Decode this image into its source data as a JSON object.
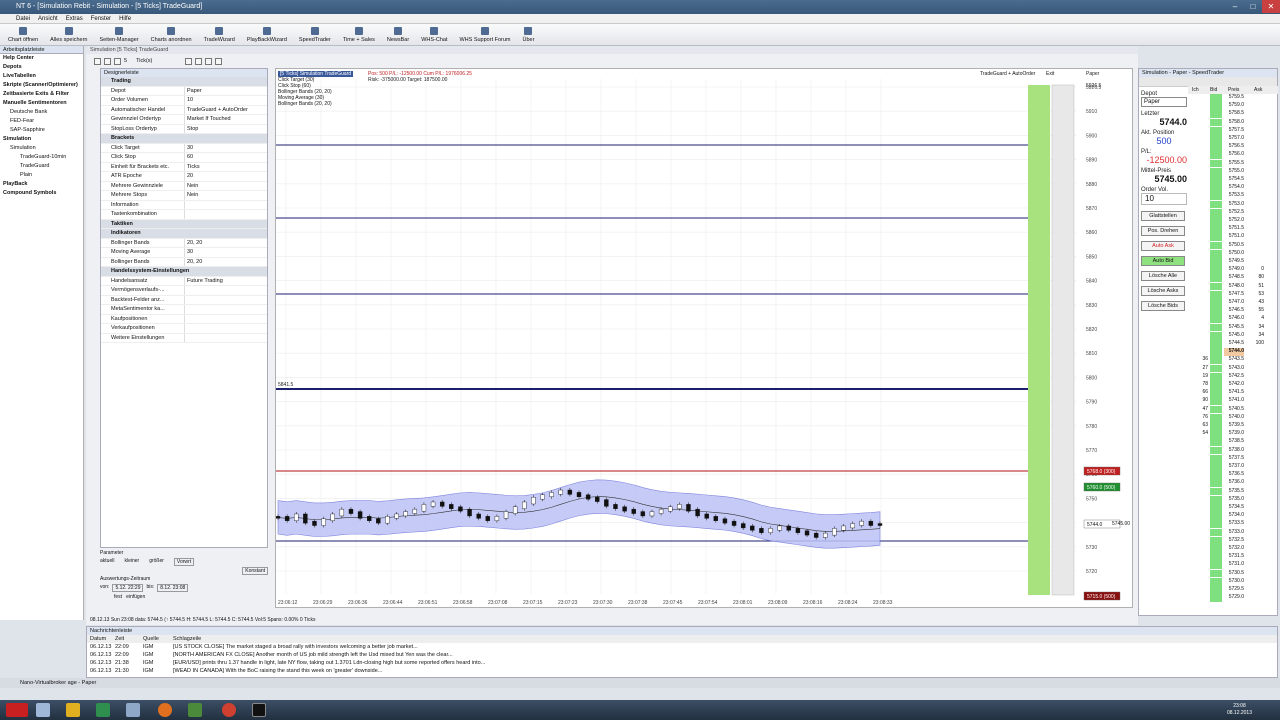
{
  "window": {
    "title": "NT 6 - [Simulation Rebit - Simulation - [5 Ticks] TradeGuard]",
    "min": "–",
    "max": "□",
    "close": "✕"
  },
  "menu": [
    "Datei",
    "Ansicht",
    "Extras",
    "Fenster",
    "Hilfe"
  ],
  "toolbar": [
    "Chart öffnen",
    "Alles speichern",
    "Seiten-Manager",
    "Charts anordnen",
    "TradeWizard",
    "PlayBackWizard",
    "SpeedTrader",
    "Time + Sales",
    "NewsBar",
    "WHS-Chat",
    "WHS Support Forum",
    "Über"
  ],
  "sidebar": {
    "header": "Arbeitsplatzleiste",
    "items": [
      {
        "label": "Help Center",
        "cls": "b"
      },
      {
        "label": "Depots",
        "cls": "b"
      },
      {
        "label": "LiveTabellen",
        "cls": "b"
      },
      {
        "label": "Skripte (Scanner/Optimierer)",
        "cls": "b"
      },
      {
        "label": "Zeitbasierte Exits & Filter",
        "cls": "b"
      },
      {
        "label": "Manuelle Sentimentoren",
        "cls": "b"
      },
      {
        "label": "Deutsche Bank",
        "cls": "l1"
      },
      {
        "label": "FED-Fear",
        "cls": "l1"
      },
      {
        "label": "SAP-Sapphire",
        "cls": "l1"
      },
      {
        "label": "Simulation",
        "cls": "b"
      },
      {
        "label": "Simulation",
        "cls": "l1"
      },
      {
        "label": "TradeGuard-10min",
        "cls": "l2"
      },
      {
        "label": "TradeGuard",
        "cls": "l2"
      },
      {
        "label": "Plain",
        "cls": "l2"
      },
      {
        "label": "PlayBack",
        "cls": "b"
      },
      {
        "label": "Compound Symbols",
        "cls": "b"
      }
    ]
  },
  "main": {
    "title": "Simulation [5 Ticks] TradeGuard",
    "period": "5",
    "unit": "Tick(s)"
  },
  "designer": {
    "header": "Designerleiste",
    "rows": [
      {
        "k": "Trading",
        "v": "",
        "sec": true
      },
      {
        "k": "Depot",
        "v": "Paper"
      },
      {
        "k": "Order Volumen",
        "v": "10"
      },
      {
        "k": "Automatischer Handel",
        "v": "TradeGuard + AutoOrder"
      },
      {
        "k": "Gewinnziel Ordertyp",
        "v": "Market If Touched"
      },
      {
        "k": "StopLoss Ordertyp",
        "v": "Stop"
      },
      {
        "k": "Brackets",
        "v": "",
        "sec": true
      },
      {
        "k": "Click Target",
        "v": "30"
      },
      {
        "k": "Click Stop",
        "v": "60"
      },
      {
        "k": "Einheit für Brackets etc.",
        "v": "Ticks"
      },
      {
        "k": "ATR Epoche",
        "v": "20"
      },
      {
        "k": "Mehrere Gewinnziele",
        "v": "Nein"
      },
      {
        "k": "Mehrere Stops",
        "v": "Nein"
      },
      {
        "k": "Information",
        "v": ""
      },
      {
        "k": "Tastenkombination",
        "v": ""
      },
      {
        "k": "Taktiken",
        "v": "",
        "sec": true
      },
      {
        "k": "Indikatoren",
        "v": "",
        "sec": true
      },
      {
        "k": "Bollinger Bands",
        "v": "20, 20"
      },
      {
        "k": "Moving Average",
        "v": "30"
      },
      {
        "k": "Bollinger Bands",
        "v": "20, 20"
      },
      {
        "k": "Handelssystem-Einstellungen",
        "v": "",
        "sec": true
      },
      {
        "k": "Handelsansatz",
        "v": "Future Trading"
      },
      {
        "k": "Vermögensverlaufs-...",
        "v": ""
      },
      {
        "k": "Backtest-Felder anz...",
        "v": ""
      },
      {
        "k": "MetaSentimentor ka...",
        "v": ""
      },
      {
        "k": "Kaufpositionen",
        "v": ""
      },
      {
        "k": "Verkaufpositionen",
        "v": ""
      },
      {
        "k": "Weitere Einstellungen",
        "v": ""
      }
    ]
  },
  "params": {
    "title": "Parameter",
    "aktuell": "aktuell",
    "kleiner": "kleiner",
    "groesser": "größer",
    "vorwrt": "Vorwrt",
    "konstant": "Konstant",
    "zeitraum": "Auswertungs-Zeitraum",
    "von_label": "von:",
    "von": "5.12. 22:29",
    "bis_label": "bis:",
    "bis": "8.12. 23:08",
    "fest": "fest",
    "einfuegen": "einfügen"
  },
  "chart": {
    "legend": [
      "[5 Ticks] Simulation TradeGuard",
      "Click Target (30)",
      "Click Stop (60)",
      "Bollinger Bands (20, 20)",
      "Moving Average (30)",
      "Bollinger Bands (20, 20)"
    ],
    "pos_info": "Pos: 500  P/L: -12500.00  Cum P/L: 1976006.25",
    "risk_info": "Risk: -375000.00  Target: 187500.00",
    "mode_label": "TradeGuard + AutoOrder",
    "exit_label": "Exit",
    "paper_label": "Paper",
    "hline_label": "5841.5",
    "top_label": "5926.5",
    "price_tags": {
      "red": "5768.0 (300)",
      "green": "5760.0 (500)",
      "cur": "5744.0",
      "cur2": "5745.00",
      "bottom": "5715.0 (500)"
    },
    "status": "08.12.13 Sun 23:08 data: 5744.5 (↑ 5744.5 H: 5744.5 L: 5744.5 C: 5744.5 Vol:5 Spans: 0.00% 0 Ticks"
  },
  "chart_data": {
    "type": "line",
    "y_ticks": [
      "5926.5",
      "5910",
      "5900",
      "5890",
      "5880",
      "5870",
      "5860",
      "5850",
      "5840",
      "5830",
      "5820",
      "5810",
      "5800",
      "5790",
      "5780",
      "5770",
      "5760",
      "5750",
      "5740",
      "5730",
      "5720"
    ],
    "x_ticks": [
      "23:06:12",
      "23:06:29",
      "23:06:36",
      "23:06:44",
      "23:06:51",
      "23:06:58",
      "23:07:08",
      "23:07:15",
      "23:07:23",
      "23:07:30",
      "23:07:38",
      "23:07:45",
      "23:07:54",
      "23:08:01",
      "23:08:09",
      "23:08:16",
      "23:08:24",
      "23:08:33"
    ],
    "ylim": [
      5715,
      5930
    ],
    "close": [
      5747,
      5746,
      5748,
      5745,
      5744,
      5746,
      5748,
      5750,
      5749,
      5747,
      5746,
      5745,
      5747,
      5748,
      5749,
      5750,
      5752,
      5753,
      5752,
      5751,
      5750,
      5748,
      5747,
      5746,
      5747,
      5749,
      5751,
      5753,
      5755,
      5756,
      5757,
      5758,
      5757,
      5756,
      5755,
      5754,
      5752,
      5751,
      5750,
      5749,
      5748,
      5749,
      5750,
      5751,
      5752,
      5750,
      5748,
      5747,
      5746,
      5745,
      5744,
      5743,
      5742,
      5741,
      5742,
      5743,
      5742,
      5741,
      5740,
      5739,
      5740,
      5742,
      5743,
      5744,
      5745,
      5744,
      5744
    ],
    "hlines": [
      5900,
      5870,
      5838,
      5803,
      5768,
      5736
    ]
  },
  "right": {
    "title": "Simulation - Paper - SpeedTrader",
    "depot_label": "Depot",
    "depot": "Paper",
    "letzter_label": "Letzter",
    "letzter": "5744.0",
    "pos_label": "Akt. Position",
    "pos": "500",
    "pl_label": "P/L:",
    "pl": "-12500.00",
    "mittel_label": "Mittel-Preis",
    "mittel": "5745.00",
    "vol_label": "Order Vol.",
    "vol": "10",
    "buttons": [
      "Glattstellen",
      "Pos. Drehen",
      "Auto Ask",
      "Auto Bid",
      "Lösche Alle",
      "Lösche Asks",
      "Lösche Bids"
    ],
    "ladder_headers": [
      "Ich",
      "Bid",
      "Preis",
      "Ask"
    ]
  },
  "ladder": [
    {
      "p": "5759.5",
      "a": "",
      "b": ""
    },
    {
      "p": "5759.0",
      "a": "",
      "b": ""
    },
    {
      "p": "5758.5",
      "a": "",
      "b": ""
    },
    {
      "p": "5758.0",
      "a": "",
      "b": ""
    },
    {
      "p": "5757.5",
      "a": "",
      "b": ""
    },
    {
      "p": "5757.0",
      "a": "",
      "b": ""
    },
    {
      "p": "5756.5",
      "a": "",
      "b": ""
    },
    {
      "p": "5756.0",
      "a": "",
      "b": ""
    },
    {
      "p": "5755.5",
      "a": "",
      "b": ""
    },
    {
      "p": "5755.0",
      "a": "",
      "b": ""
    },
    {
      "p": "5754.5",
      "a": "",
      "b": ""
    },
    {
      "p": "5754.0",
      "a": "",
      "b": ""
    },
    {
      "p": "5753.5",
      "a": "",
      "b": ""
    },
    {
      "p": "5753.0",
      "a": "",
      "b": ""
    },
    {
      "p": "5752.5",
      "a": "",
      "b": ""
    },
    {
      "p": "5752.0",
      "a": "",
      "b": ""
    },
    {
      "p": "5751.5",
      "a": "",
      "b": ""
    },
    {
      "p": "5751.0",
      "a": "",
      "b": ""
    },
    {
      "p": "5750.5",
      "a": "",
      "b": ""
    },
    {
      "p": "5750.0",
      "a": "",
      "b": ""
    },
    {
      "p": "5749.5",
      "a": "",
      "b": ""
    },
    {
      "p": "5749.0",
      "a": "",
      "b": "0"
    },
    {
      "p": "5748.5",
      "a": "",
      "b": "80"
    },
    {
      "p": "5748.0",
      "a": "",
      "b": "51"
    },
    {
      "p": "5747.5",
      "a": "",
      "b": "53"
    },
    {
      "p": "5747.0",
      "a": "",
      "b": "43"
    },
    {
      "p": "5746.5",
      "a": "",
      "b": "55"
    },
    {
      "p": "5746.0",
      "a": "",
      "b": "4"
    },
    {
      "p": "5745.5",
      "a": "",
      "b": "34"
    },
    {
      "p": "5745.0",
      "a": "",
      "b": "34"
    },
    {
      "p": "5744.5",
      "a": "",
      "b": "100"
    },
    {
      "p": "5744.0",
      "a": "",
      "b": ""
    },
    {
      "p": "5743.5",
      "a": "36",
      "b": ""
    },
    {
      "p": "5743.0",
      "a": "27",
      "b": ""
    },
    {
      "p": "5742.5",
      "a": "19",
      "b": ""
    },
    {
      "p": "5742.0",
      "a": "78",
      "b": ""
    },
    {
      "p": "5741.5",
      "a": "66",
      "b": ""
    },
    {
      "p": "5741.0",
      "a": "90",
      "b": ""
    },
    {
      "p": "5740.5",
      "a": "47",
      "b": ""
    },
    {
      "p": "5740.0",
      "a": "76",
      "b": ""
    },
    {
      "p": "5739.5",
      "a": "63",
      "b": ""
    },
    {
      "p": "5739.0",
      "a": "54",
      "b": ""
    },
    {
      "p": "5738.5",
      "a": "",
      "b": ""
    },
    {
      "p": "5738.0",
      "a": "",
      "b": ""
    },
    {
      "p": "5737.5",
      "a": "",
      "b": ""
    },
    {
      "p": "5737.0",
      "a": "",
      "b": ""
    },
    {
      "p": "5736.5",
      "a": "",
      "b": ""
    },
    {
      "p": "5736.0",
      "a": "",
      "b": ""
    },
    {
      "p": "5735.5",
      "a": "",
      "b": ""
    },
    {
      "p": "5735.0",
      "a": "",
      "b": ""
    },
    {
      "p": "5734.5",
      "a": "",
      "b": ""
    },
    {
      "p": "5734.0",
      "a": "",
      "b": ""
    },
    {
      "p": "5733.5",
      "a": "",
      "b": ""
    },
    {
      "p": "5733.0",
      "a": "",
      "b": ""
    },
    {
      "p": "5732.5",
      "a": "",
      "b": ""
    },
    {
      "p": "5732.0",
      "a": "",
      "b": ""
    },
    {
      "p": "5731.5",
      "a": "",
      "b": ""
    },
    {
      "p": "5731.0",
      "a": "",
      "b": ""
    },
    {
      "p": "5730.5",
      "a": "",
      "b": ""
    },
    {
      "p": "5730.0",
      "a": "",
      "b": ""
    },
    {
      "p": "5729.5",
      "a": "",
      "b": ""
    },
    {
      "p": "5729.0",
      "a": "",
      "b": ""
    }
  ],
  "news": {
    "title": "Nachrichtenleiste",
    "headers": [
      "Datum",
      "Zeit",
      "Quelle",
      "Schlagzeile"
    ],
    "rows": [
      [
        "06.12.13",
        "22:09",
        "IGM",
        "[US STOCK CLOSE] The market staged a broad rally with investors welcoming a better job market..."
      ],
      [
        "06.12.13",
        "22:09",
        "IGM",
        "[NORTH AMERICAN FX CLOSE] Another month of US job mild strength left the Usd mixed but Yen was the clear..."
      ],
      [
        "06.12.13",
        "21:38",
        "IGM",
        "[EUR/USD] prints thru 1.37 handle in light, late NY flow, taking out 1.3701 Ldn-closing high but some reported offers heard into..."
      ],
      [
        "06.12.13",
        "21:30",
        "IGM",
        "[WEAD IN CANADA] With the BoC raising the stand this week on 'greater' downside..."
      ]
    ]
  },
  "bottom": {
    "tab": "Nano-Virtualbroker age - Paper"
  },
  "taskbar": {
    "time": "23:08",
    "date": "08.12.2013"
  },
  "colors": {
    "band": "#bcc3f5",
    "hline": "#1b1f6e",
    "red_line": "#b01010",
    "green_bar": "#a7e27f"
  }
}
